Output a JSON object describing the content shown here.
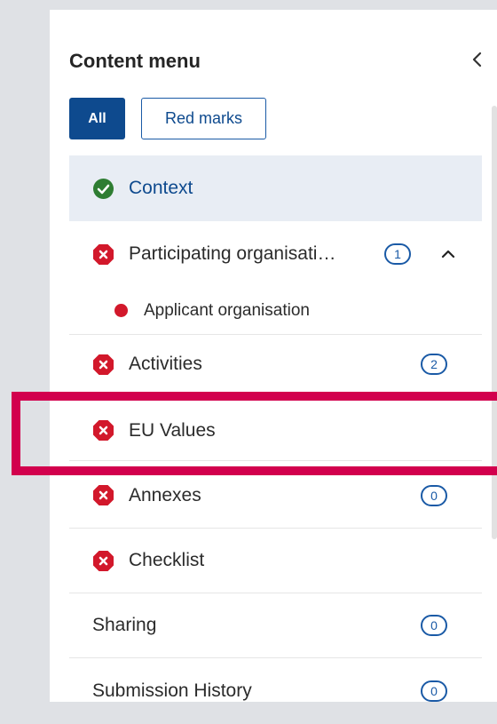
{
  "panel": {
    "title": "Content menu",
    "collapse_icon": "chevron-left-icon"
  },
  "filters": {
    "all_label": "All",
    "red_marks_label": "Red marks",
    "selected": "All"
  },
  "colors": {
    "primary": "#0e4a8e",
    "error": "#d2182b",
    "success": "#2e7d32",
    "highlight": "#d2004d",
    "active_bg": "#e8edf4"
  },
  "menu": {
    "context": {
      "label": "Context",
      "status": "complete",
      "icon": "check-circle-icon"
    },
    "participating": {
      "label": "Participating organisati…",
      "status": "error",
      "icon": "error-octagon-icon",
      "badge": "1",
      "expanded": true
    },
    "applicant": {
      "label": "Applicant organisation",
      "status": "error",
      "icon": "red-dot-icon"
    },
    "activities": {
      "label": "Activities",
      "status": "error",
      "icon": "error-octagon-icon",
      "badge": "2"
    },
    "eu_values": {
      "label": "EU Values",
      "status": "error",
      "icon": "error-octagon-icon",
      "highlighted": true
    },
    "annexes": {
      "label": "Annexes",
      "status": "error",
      "icon": "error-octagon-icon",
      "badge": "0"
    },
    "checklist": {
      "label": "Checklist",
      "status": "error",
      "icon": "error-octagon-icon"
    },
    "sharing": {
      "label": "Sharing",
      "badge": "0"
    },
    "submission_history": {
      "label": "Submission History",
      "badge": "0"
    }
  }
}
